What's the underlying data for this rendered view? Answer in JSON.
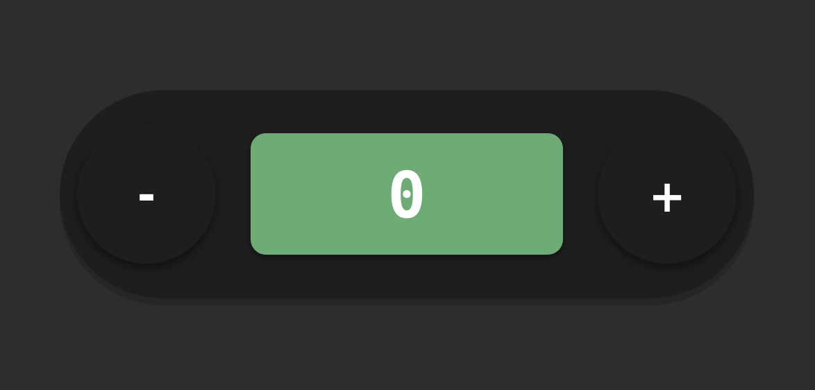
{
  "counter": {
    "decrement_label": "-",
    "increment_label": "+",
    "value": "0"
  },
  "colors": {
    "background": "#2d2d2d",
    "pill": "#1e1e1e",
    "display_accent": "#6fab77",
    "text": "#ffffff"
  },
  "icons": {
    "decrement": "minus-icon",
    "increment": "plus-icon"
  }
}
